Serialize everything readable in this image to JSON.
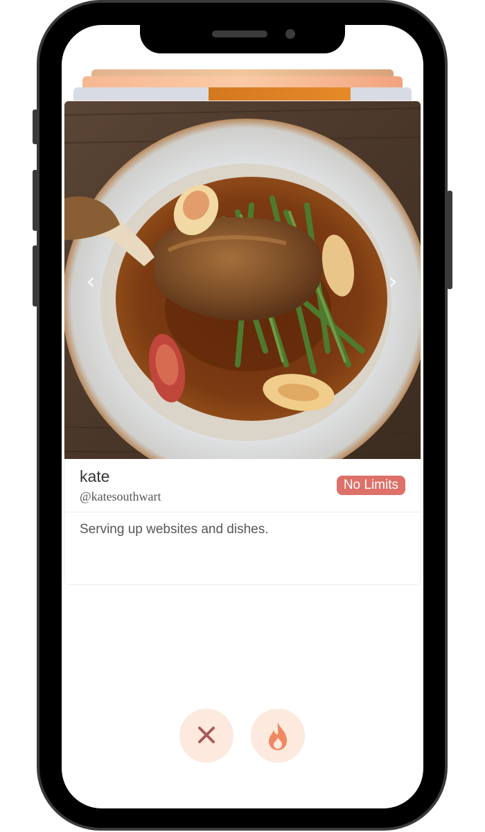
{
  "profile": {
    "name": "kate",
    "handle": "@katesouthwart",
    "badge": "No Limits",
    "bio": "Serving up websites and dishes."
  },
  "carousel": {
    "prev_icon": "chevron-left-icon",
    "next_icon": "chevron-right-icon",
    "prev_glyph": "‹",
    "next_glyph": "›"
  },
  "actions": {
    "dislike_icon": "close-icon",
    "like_icon": "flame-icon"
  },
  "colors": {
    "badge": "#dd7169",
    "action_bg": "#fde9de",
    "close": "#a85a5a",
    "flame": "#ef8860"
  }
}
